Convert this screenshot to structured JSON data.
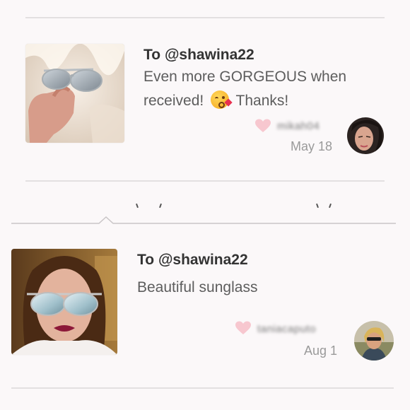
{
  "reviews": [
    {
      "to_label": "To",
      "handle": "@shawina22",
      "message_part1": "Even more GORGEOUS when",
      "message_part2": "received!",
      "message_part3": "Thanks!",
      "username": "mikah04",
      "date": "May 18"
    },
    {
      "to_label": "To",
      "handle": "@shawina22",
      "message": "Beautiful sunglass",
      "username": "taniacaputo",
      "date": "Aug 1"
    }
  ],
  "icons": {
    "heart": "heart-icon",
    "emoji": "kissing-face-emoji-icon"
  },
  "colors": {
    "heart": "#f7c7cf",
    "background": "#fbf8f9",
    "divider": "#e3e0e1"
  }
}
